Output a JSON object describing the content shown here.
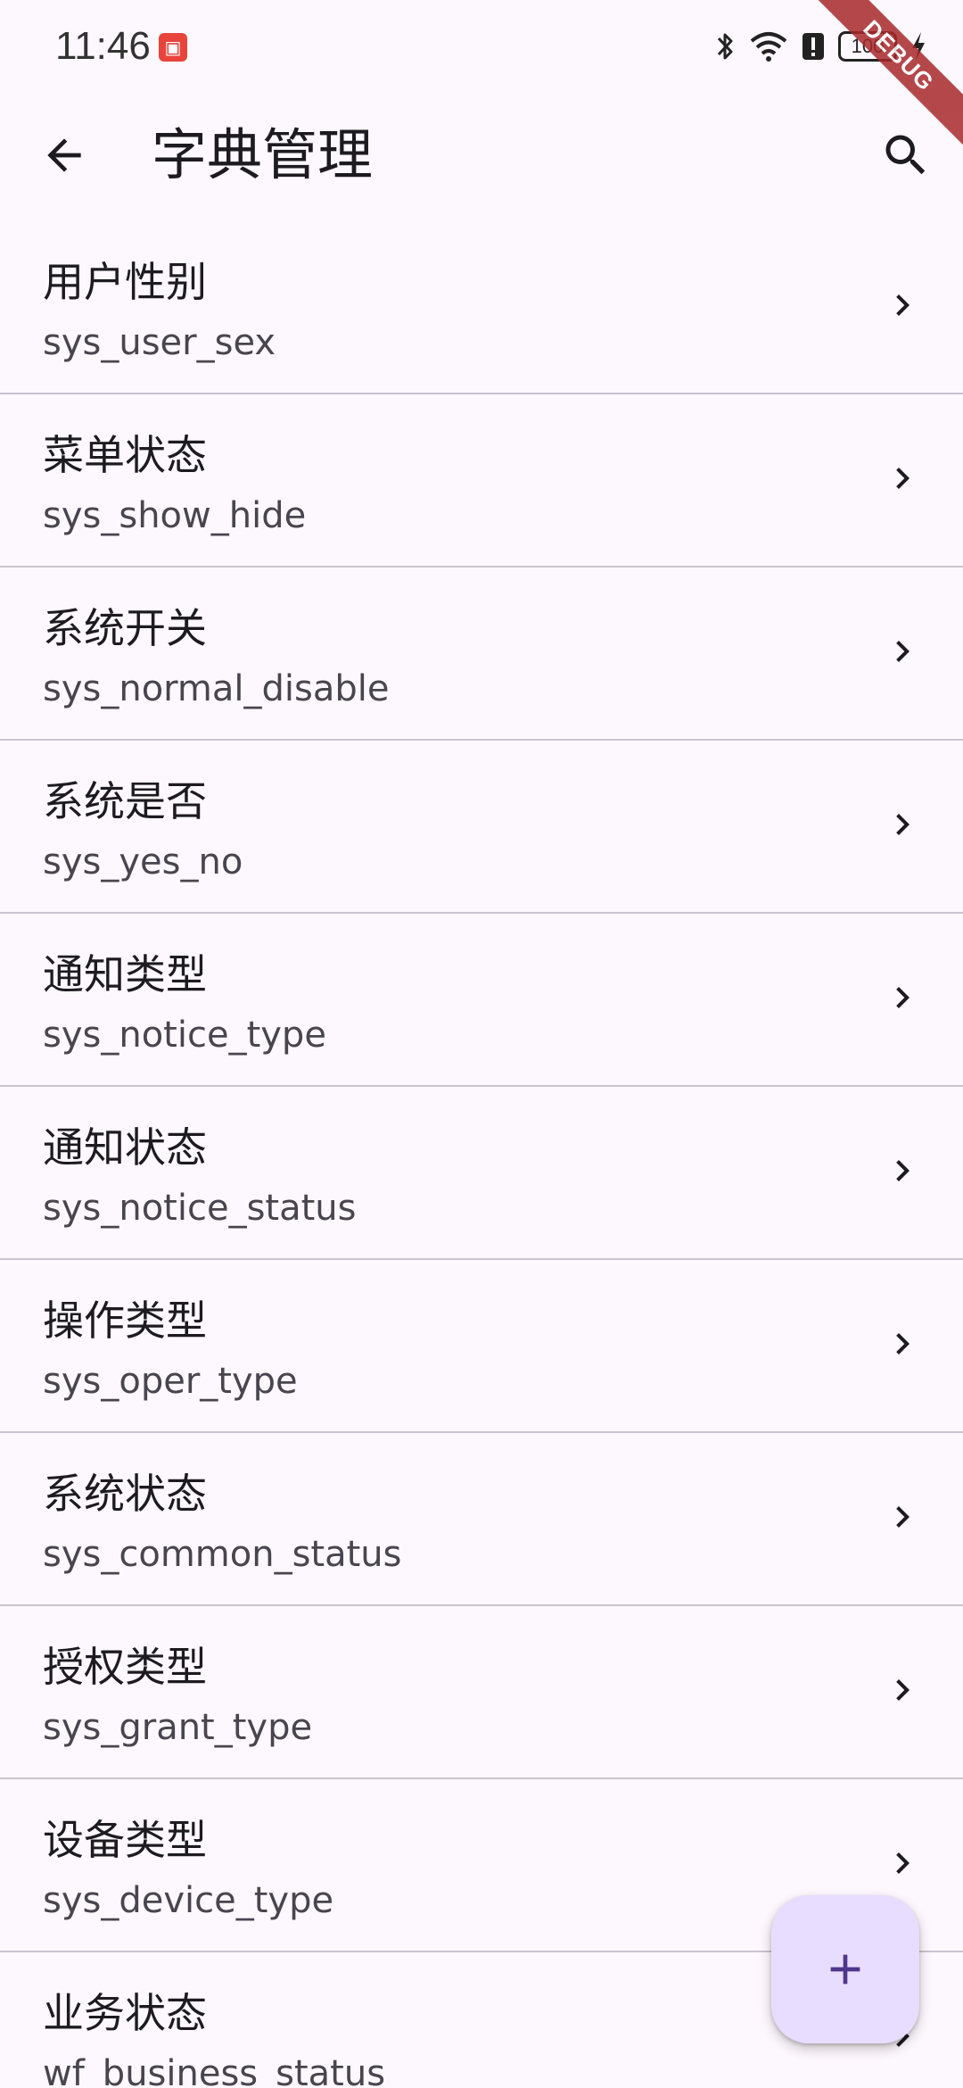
{
  "status_bar": {
    "time": "11:46",
    "battery": "100",
    "notification_icon": "huawei-app-icon",
    "icons": [
      "bluetooth-icon",
      "wifi-icon",
      "alert-icon",
      "battery-icon",
      "charging-icon"
    ]
  },
  "debug_banner": "DEBUG",
  "app_bar": {
    "title": "字典管理",
    "back_icon": "arrow-back-icon",
    "search_icon": "search-icon"
  },
  "dict_list": [
    {
      "name": "用户性别",
      "type": "sys_user_sex"
    },
    {
      "name": "菜单状态",
      "type": "sys_show_hide"
    },
    {
      "name": "系统开关",
      "type": "sys_normal_disable"
    },
    {
      "name": "系统是否",
      "type": "sys_yes_no"
    },
    {
      "name": "通知类型",
      "type": "sys_notice_type"
    },
    {
      "name": "通知状态",
      "type": "sys_notice_status"
    },
    {
      "name": "操作类型",
      "type": "sys_oper_type"
    },
    {
      "name": "系统状态",
      "type": "sys_common_status"
    },
    {
      "name": "授权类型",
      "type": "sys_grant_type"
    },
    {
      "name": "设备类型",
      "type": "sys_device_type"
    },
    {
      "name": "业务状态",
      "type": "wf_business_status"
    }
  ],
  "fab": {
    "icon": "add-icon"
  },
  "colors": {
    "background": "#fdf8fd",
    "fab_background": "#e9ddff",
    "fab_icon": "#4f378b",
    "divider": "#cac4cf",
    "debug_ribbon": "#a8292b"
  }
}
